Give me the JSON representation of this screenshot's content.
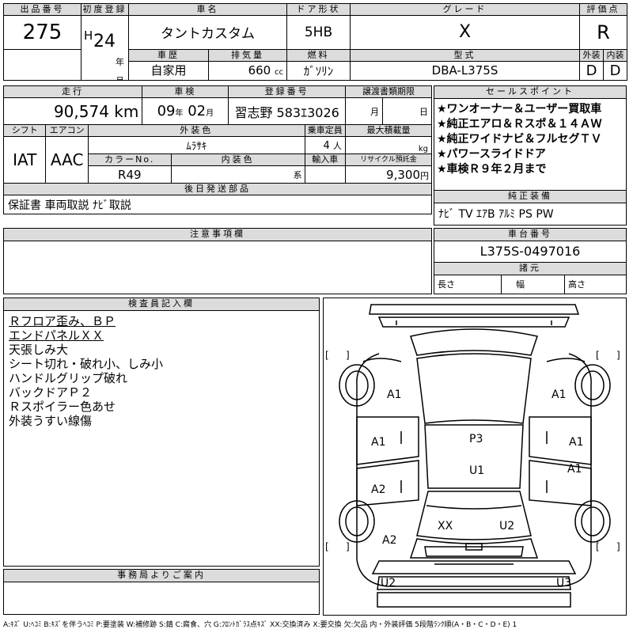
{
  "header_labels": {
    "lot": "出品番号",
    "first_reg": "初度登録",
    "car_name": "車名",
    "door": "ドア形状",
    "grade": "グレード",
    "score": "評価点",
    "history": "車歴",
    "displacement": "排気量",
    "fuel": "燃料",
    "model": "型式",
    "exterior": "外装",
    "interior": "内装",
    "mileage": "走行",
    "inspection": "車検",
    "reg_no": "登録番号",
    "transfer": "譲渡書類期限",
    "selling": "セールスポイント",
    "shift": "シフト",
    "aircon": "エアコン",
    "ext_color": "外装色",
    "capacity": "乗車定員",
    "max_load": "最大積載量",
    "color_no": "カラーNo.",
    "int_color": "内装色",
    "import": "輸入車",
    "recycle": "リサイクル預託金",
    "later_parts": "後日発送部品",
    "genuine": "純正装備",
    "notes": "注意事項欄",
    "chassis": "車台番号",
    "specs": "諸元",
    "inspector": "検査員記入欄",
    "office": "事務局よりご案内"
  },
  "lot_number": "275",
  "era": "H",
  "year": "24",
  "year_unit": "年",
  "month_unit": "月",
  "car_name": "タントカスタム",
  "door_type": "5HB",
  "grade": "X",
  "score": "R",
  "history": "自家用",
  "displacement": "660",
  "displacement_unit": "cc",
  "fuel": "ｶﾞｿﾘﾝ",
  "model_code": "DBA-L375S",
  "exterior_grade": "D",
  "interior_grade": "D",
  "mileage": "90,574",
  "mileage_unit": "km",
  "inspection_year": "09",
  "inspection_month": "02",
  "reg_number": "習志野 583ｴ3026",
  "transfer_month": "月",
  "transfer_day": "日",
  "selling_points": [
    "★ワンオーナー＆ユーザー買取車",
    "★純正エアロ＆Ｒスポ＆１４ＡＷ",
    "★純正ワイドナビ＆フルセグＴＶ",
    "★パワースライドドア",
    "★車検Ｒ９年２月まで"
  ],
  "shift": "IAT",
  "aircon": "AAC",
  "ext_color": "ﾑﾗｻｷ",
  "capacity": "4",
  "capacity_unit": "人",
  "load_unit": "kg",
  "color_no": "R49",
  "int_color_unit": "系",
  "recycle_fee": "9,300",
  "recycle_unit": "円",
  "later_parts": "保証書 車両取説 ﾅﾋﾞ取説",
  "genuine_equipment": "ﾅﾋﾞ TV ｴｱB ｱﾙﾐ PS PW",
  "chassis_number": "L375S-0497016",
  "spec_length": "長さ",
  "spec_width": "幅",
  "spec_height": "高さ",
  "inspector_notes": [
    "Ｒフロア歪み、ＢＰ",
    "エンドパネルＸＸ",
    "天張しみ大",
    "シート切れ・破れ小、しみ小",
    "ハンドルグリップ破れ",
    "バックドアＰ２",
    "Ｒスポイラー色あせ",
    "外装うすい線傷"
  ],
  "damage_marks": {
    "fl_fender": "A1",
    "fr_fender": "A1",
    "l_front_door": "A1",
    "r_front_door": "A1",
    "l_rear_door": "A2",
    "r_rear_door": "A1",
    "l_quarter": "A2",
    "roof": "P3",
    "cabin": "U1",
    "back_left": "XX",
    "back_right": "U2",
    "rear_bumper_l": "U2",
    "rear_bumper_r": "U3"
  },
  "footer_legend": "A:ｷｽﾞ U:ﾍｺﾐ B:ｷｽﾞを伴うﾍｺﾐ P:要塗装 W:補修跡 S:錆 C:腐食、穴 G:ﾌﾛﾝﾄｶﾞﾗｽ点ｷｽﾞ XX:交換済み X:要交換 欠:欠品 内・外装評価 5段階ﾗﾝｸ順(A・B・C・D・E) 1"
}
